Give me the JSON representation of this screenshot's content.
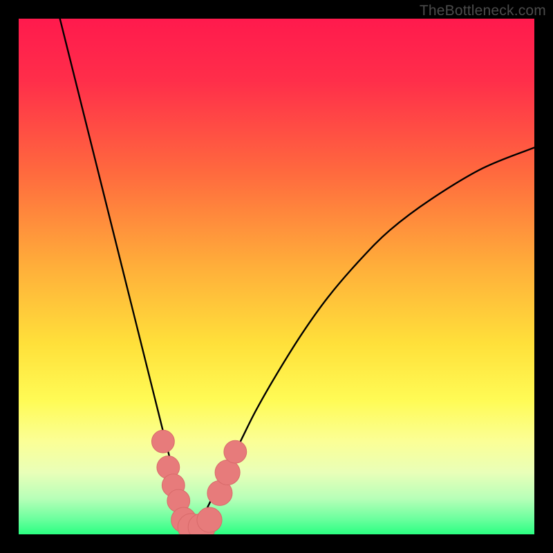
{
  "watermark": {
    "text": "TheBottleneck.com"
  },
  "colors": {
    "frame": "#000000",
    "gradient_stops": [
      {
        "offset": 0.0,
        "color": "#ff1a4d"
      },
      {
        "offset": 0.12,
        "color": "#ff2e4a"
      },
      {
        "offset": 0.3,
        "color": "#ff6a3e"
      },
      {
        "offset": 0.48,
        "color": "#ffae3a"
      },
      {
        "offset": 0.63,
        "color": "#ffe03a"
      },
      {
        "offset": 0.74,
        "color": "#fffb55"
      },
      {
        "offset": 0.82,
        "color": "#fbff96"
      },
      {
        "offset": 0.88,
        "color": "#e9ffb8"
      },
      {
        "offset": 0.93,
        "color": "#b8ffb8"
      },
      {
        "offset": 0.97,
        "color": "#6cff9e"
      },
      {
        "offset": 1.0,
        "color": "#2bff82"
      }
    ],
    "curve": "#000000",
    "marker_fill": "#e77b7b",
    "marker_stroke": "#d86a6a"
  },
  "chart_data": {
    "type": "line",
    "title": "",
    "xlabel": "",
    "ylabel": "",
    "xlim": [
      0,
      100
    ],
    "ylim": [
      0,
      100
    ],
    "grid": false,
    "series": [
      {
        "name": "bottleneck-curve",
        "x": [
          8,
          10,
          12,
          14,
          16,
          18,
          20,
          22,
          24,
          26,
          28,
          30,
          31,
          32,
          33,
          34,
          35,
          36,
          38,
          40,
          43,
          46,
          50,
          55,
          60,
          66,
          72,
          80,
          90,
          100
        ],
        "y": [
          100,
          92,
          84,
          76,
          68,
          60,
          52,
          44,
          36,
          28,
          20,
          12,
          8,
          4,
          2,
          1,
          2,
          4,
          8,
          12,
          18,
          24,
          31,
          39,
          46,
          53,
          59,
          65,
          71,
          75
        ]
      }
    ],
    "markers": [
      {
        "name": "left-cluster-1",
        "x": 28.0,
        "y": 18.0,
        "r": 2.0
      },
      {
        "name": "left-cluster-2",
        "x": 29.0,
        "y": 13.0,
        "r": 2.0
      },
      {
        "name": "left-cluster-3",
        "x": 30.0,
        "y": 9.5,
        "r": 2.0
      },
      {
        "name": "left-cluster-4",
        "x": 31.0,
        "y": 6.5,
        "r": 2.0
      },
      {
        "name": "bottom-blob-a",
        "x": 32.0,
        "y": 2.8,
        "r": 2.2
      },
      {
        "name": "bottom-blob-b",
        "x": 33.5,
        "y": 1.4,
        "r": 2.4
      },
      {
        "name": "bottom-blob-c",
        "x": 35.5,
        "y": 1.4,
        "r": 2.4
      },
      {
        "name": "bottom-blob-d",
        "x": 37.0,
        "y": 2.8,
        "r": 2.2
      },
      {
        "name": "right-cluster-1",
        "x": 39.0,
        "y": 8.0,
        "r": 2.2
      },
      {
        "name": "right-cluster-2",
        "x": 40.5,
        "y": 12.0,
        "r": 2.2
      },
      {
        "name": "right-cluster-3",
        "x": 42.0,
        "y": 16.0,
        "r": 2.0
      }
    ]
  }
}
